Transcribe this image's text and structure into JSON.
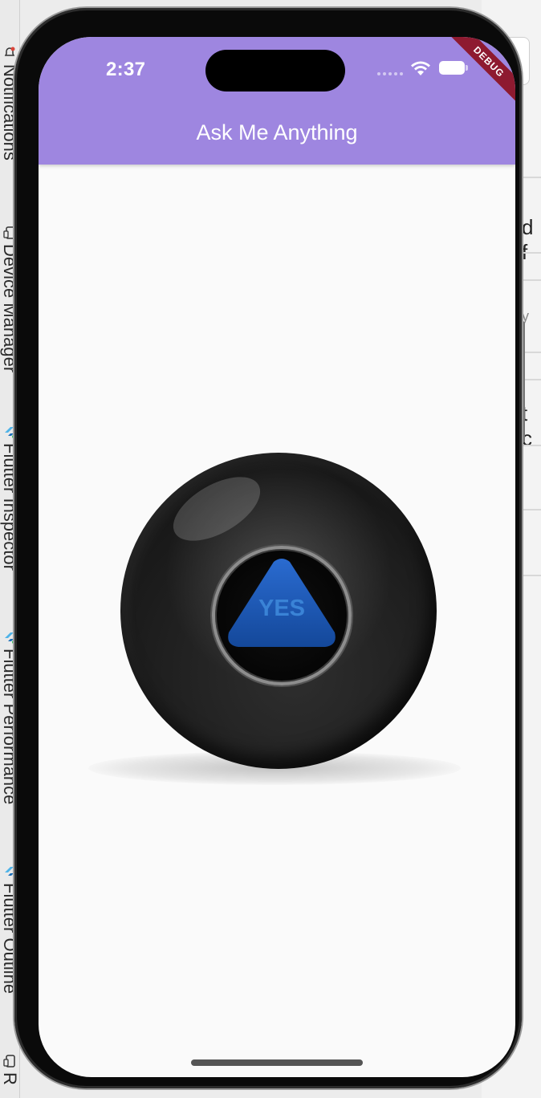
{
  "ide": {
    "tabs": [
      {
        "label": "Notifications",
        "icon": "bell-icon"
      },
      {
        "label": "Device Manager",
        "icon": "phone-icon"
      },
      {
        "label": "Flutter Inspector",
        "icon": "flutter-icon"
      },
      {
        "label": "Flutter Performance",
        "icon": "flutter-icon"
      },
      {
        "label": "Flutter Outline",
        "icon": "flutter-icon"
      },
      {
        "label": "R",
        "icon": "phone-icon"
      }
    ]
  },
  "background_fragments": [
    "d f",
    "y",
    "t c"
  ],
  "status_bar": {
    "time": "2:37"
  },
  "debug_banner": "DEBUG",
  "app": {
    "title": "Ask Me Anything",
    "bar_color": "#9e86e0",
    "ball": {
      "answer": "YES",
      "answer_color": "#3a83d6"
    }
  }
}
